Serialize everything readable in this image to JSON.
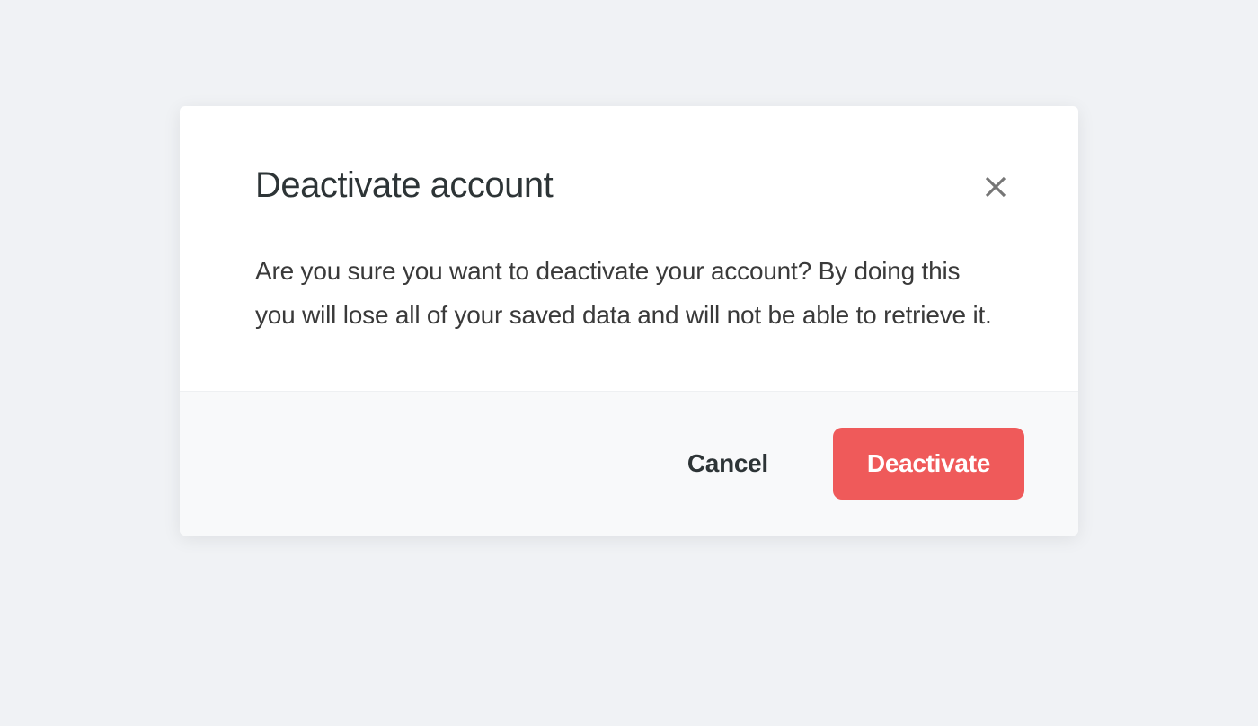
{
  "modal": {
    "title": "Deactivate account",
    "message": "Are you sure you want to deactivate your account? By doing this you will lose all of your saved data and will not be able to retrieve it.",
    "buttons": {
      "cancel": "Cancel",
      "confirm": "Deactivate"
    }
  }
}
